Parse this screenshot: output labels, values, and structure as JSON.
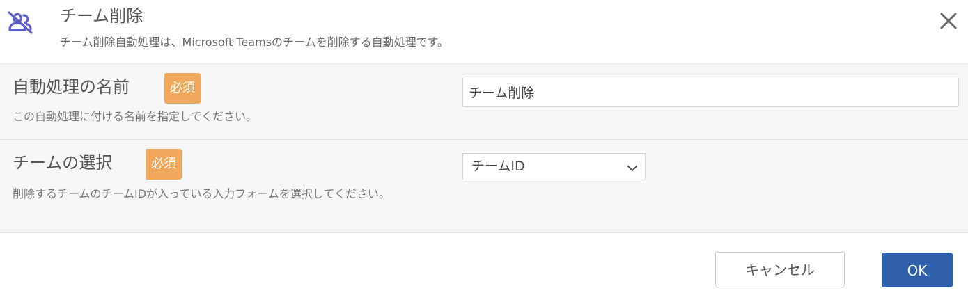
{
  "header": {
    "icon": "team-remove-icon",
    "title": "チーム削除",
    "description": "チーム削除自動処理は、Microsoft Teamsのチームを削除する自動処理です。",
    "close_icon": "close-icon",
    "accent_color": "#5b5fc7"
  },
  "fields": {
    "name": {
      "label": "自動処理の名前",
      "required": "必須",
      "help": "この自動処理に付ける名前を指定してください。",
      "value": "チーム削除"
    },
    "team": {
      "label": "チームの選択",
      "required": "必須",
      "help": "削除するチームのチームIDが入っている入力フォームを選択してください。",
      "selected": "チームID",
      "chevron_icon": "chevron-down-icon"
    }
  },
  "footer": {
    "cancel_label": "キャンセル",
    "ok_label": "OK",
    "ok_color": "#2f5fab"
  },
  "colors": {
    "required_badge": "#f0a95c"
  }
}
